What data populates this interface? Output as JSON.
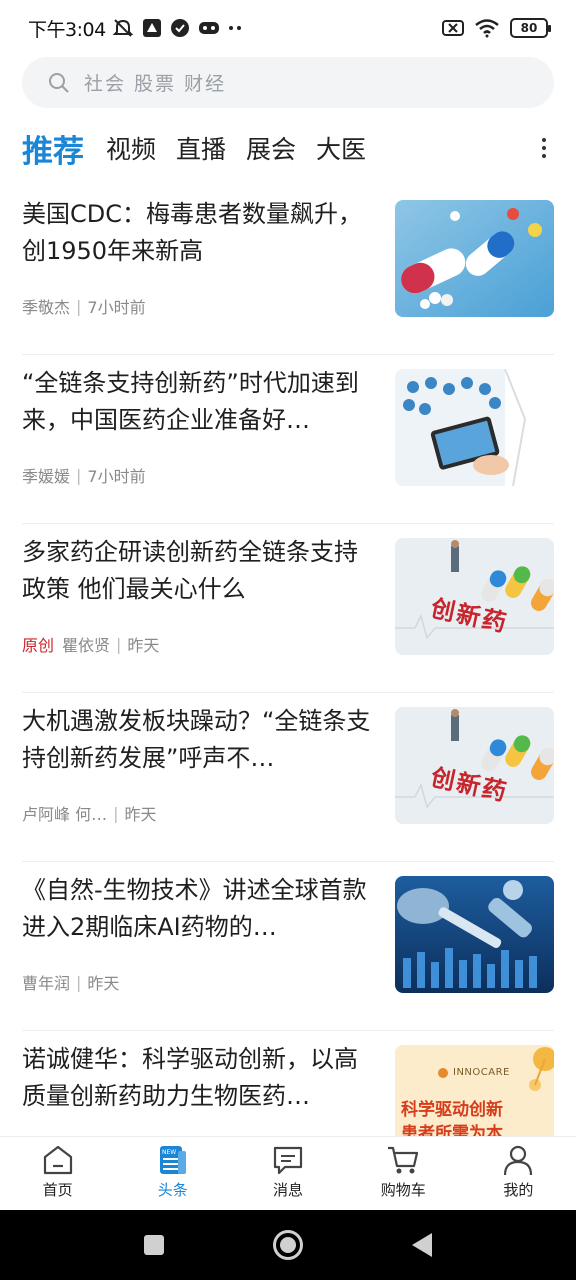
{
  "status_bar": {
    "time": "下午3:04",
    "battery": "80"
  },
  "search": {
    "placeholder": "社会 股票 财经"
  },
  "tabs": [
    {
      "label": "推荐",
      "active": true
    },
    {
      "label": "视频",
      "active": false
    },
    {
      "label": "直播",
      "active": false
    },
    {
      "label": "展会",
      "active": false
    },
    {
      "label": "大医",
      "active": false
    }
  ],
  "feed": [
    {
      "title": "美国CDC：梅毒患者数量飙升，创1950年来新高",
      "tag": "",
      "author": "季敬杰",
      "time": "7小时前",
      "thumb_icon": "pills-photo"
    },
    {
      "title": "“全链条支持创新药”时代加速到来，中国医药企业准备好…",
      "tag": "",
      "author": "季媛媛",
      "time": "7小时前",
      "thumb_icon": "doctor-tablet-photo"
    },
    {
      "title": "多家药企研读创新药全链条支持政策 他们最关心什么",
      "tag": "原创",
      "author": "瞿依贤",
      "time": "昨天",
      "thumb_icon": "innovative-drug-photo",
      "thumb_text": "创新药"
    },
    {
      "title": "大机遇激发板块躁动？“全链条支持创新药发展”呼声不…",
      "tag": "",
      "author": "卢阿峰 何…",
      "time": "昨天",
      "thumb_icon": "innovative-drug-photo",
      "thumb_text": "创新药"
    },
    {
      "title": "《自然-生物技术》讲述全球首款进入2期临床AI药物的…",
      "tag": "",
      "author": "曹年润",
      "time": "昨天",
      "thumb_icon": "lab-pipette-photo"
    },
    {
      "title": "诺诚健华：科学驱动创新，以高质量创新药助力生物医药…",
      "tag": "",
      "author": "",
      "time": "",
      "thumb_icon": "innocare-banner",
      "thumb_brand": "INNOCARE",
      "thumb_slogan_1": "科学驱动创新",
      "thumb_slogan_2": "患者所需为本"
    }
  ],
  "bottom_nav": [
    {
      "label": "首页",
      "icon": "home-icon",
      "active": false
    },
    {
      "label": "头条",
      "icon": "news-icon",
      "active": true
    },
    {
      "label": "消息",
      "icon": "message-icon",
      "active": false
    },
    {
      "label": "购物车",
      "icon": "cart-icon",
      "active": false
    },
    {
      "label": "我的",
      "icon": "profile-icon",
      "active": false
    }
  ],
  "colors": {
    "accent": "#1b86d6",
    "original_tag": "#c8282d",
    "meta_text": "#8a8a8a"
  }
}
